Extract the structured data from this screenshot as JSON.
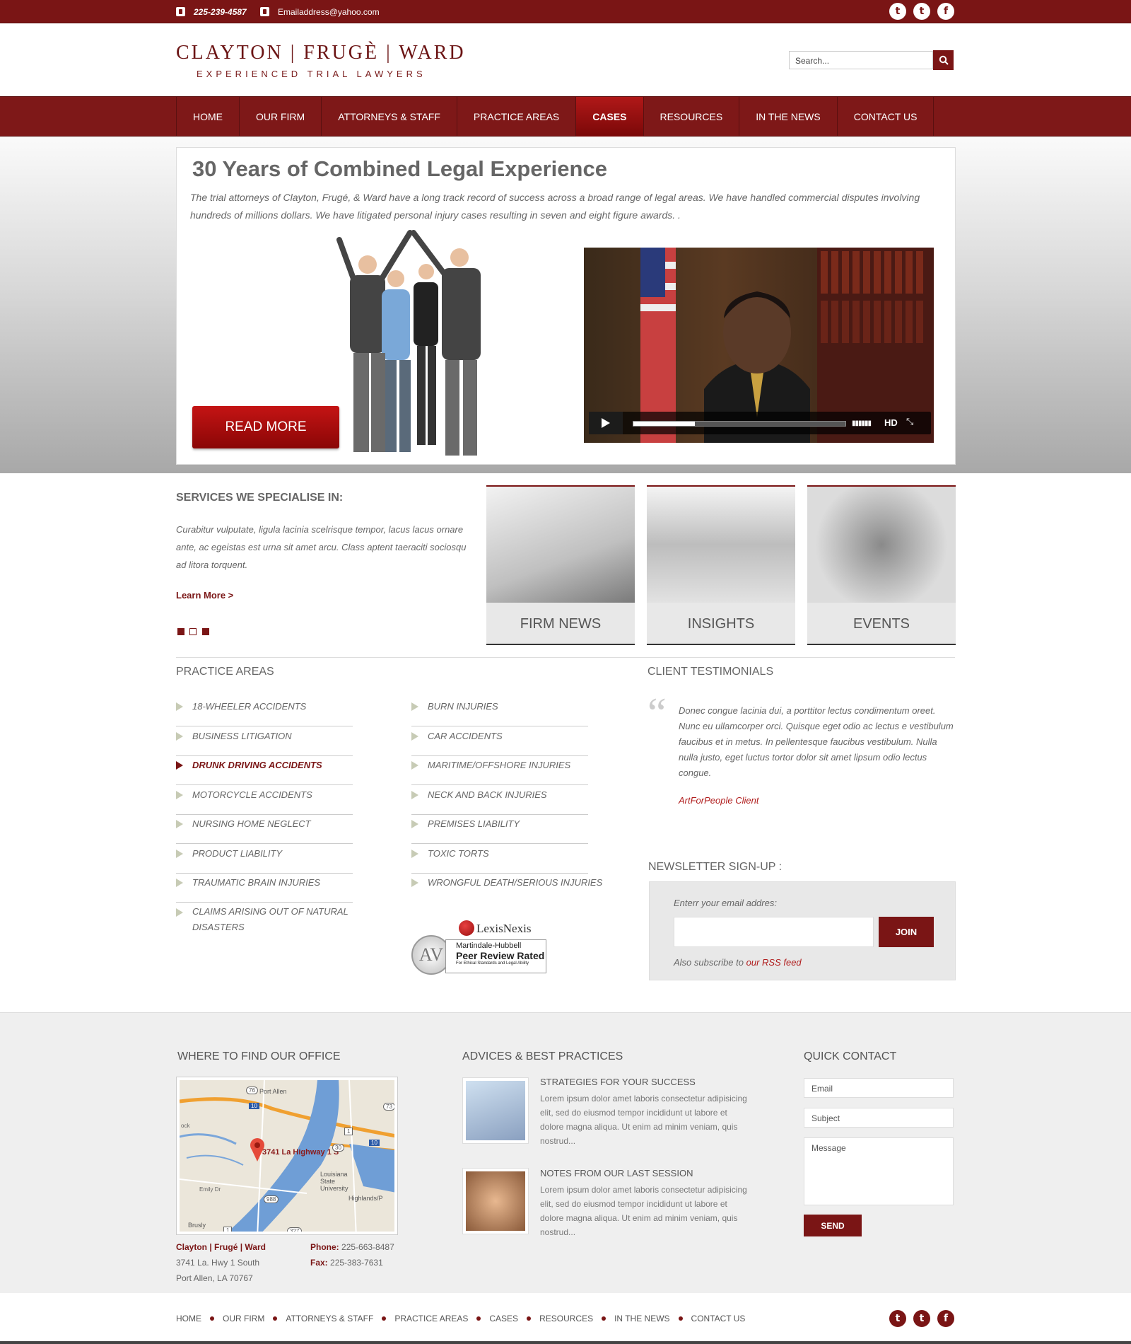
{
  "topbar": {
    "phone": "225-239-4587",
    "email": "Emailaddress@yahoo.com",
    "social": [
      "twitter-icon",
      "tumblr-icon",
      "facebook-icon"
    ]
  },
  "header": {
    "logo_title": "CLAYTON | FRUGÈ | WARD",
    "logo_subtitle": "EXPERIENCED TRIAL LAWYERS",
    "search_value": "Search..."
  },
  "nav": {
    "items": [
      "HOME",
      "OUR FIRM",
      "ATTORNEYS & STAFF",
      "PRACTICE AREAS",
      "CASES",
      "RESOURCES",
      "IN THE NEWS",
      "CONTACT US"
    ],
    "active": "CASES"
  },
  "hero": {
    "title": "30 Years of Combined Legal Experience",
    "text": "The trial attorneys of Clayton, Frugé, & Ward have a long track record of success across a broad range of legal areas. We have handled commercial disputes involving hundreds of millions dollars. We have litigated personal injury cases resulting in seven and eight figure awards. .",
    "button": "READ MORE",
    "video_hd": "HD",
    "video_progress": 0.29
  },
  "services": {
    "title": "SERVICES WE SPECIALISE IN:",
    "text": "Curabitur vulputate, ligula lacinia scelrisque tempor, lacus lacus ornare ante, ac egeistas est urna sit amet arcu. Class aptent taeraciti sociosqu ad litora torquent.",
    "learn_more": "Learn More   >",
    "cards": [
      "FIRM NEWS",
      "INSIGHTS",
      "EVENTS"
    ]
  },
  "practice": {
    "title": "PRACTICE AREAS",
    "col1": [
      "18-WHEELER ACCIDENTS",
      "BUSINESS LITIGATION",
      "DRUNK DRIVING ACCIDENTS",
      "MOTORCYCLE ACCIDENTS",
      "NURSING HOME NEGLECT",
      "PRODUCT LIABILITY",
      "TRAUMATIC BRAIN INJURIES",
      "CLAIMS ARISING OUT OF NATURAL DISASTERS"
    ],
    "col2": [
      "BURN INJURIES",
      "CAR ACCIDENTS",
      "MARITIME/OFFSHORE INJURIES",
      "NECK AND BACK INJURIES",
      "PREMISES LIABILITY",
      "TOXIC TORTS",
      "WRONGFUL DEATH/SERIOUS INJURIES"
    ],
    "active": "DRUNK DRIVING ACCIDENTS"
  },
  "lexis": {
    "brand": "LexisNexis",
    "line1": "Martindale-Hubbell",
    "line2": "Peer Review Rated",
    "line3": "For Ethical Standards and Legal Ability",
    "av": "AV"
  },
  "testimonials": {
    "title": "CLIENT TESTIMONIALS",
    "quote": "Donec congue lacinia dui, a porttitor lectus condimentum oreet. Nunc eu ullamcorper orci. Quisque eget odio ac lectus e vestibulum faucibus et in metus. In pellentesque faucibus vestibulum. Nulla nulla justo, eget luctus tortor dolor sit amet lipsum odio lectus congue.",
    "author": "ArtForPeople Client"
  },
  "newsletter": {
    "title": "NEWSLETTER SIGN-UP :",
    "label": "Enterr your email addres:",
    "button": "JOIN",
    "rss_prefix": "Also subscribe to ",
    "rss_link": "our RSS feed"
  },
  "footer": {
    "office_title": "WHERE TO FIND OUR OFFICE",
    "map_label": "3741 La Highway 1 S",
    "map_places": [
      "Port Allen",
      "Louisiana State University",
      "Highlands/P",
      "Emily Dr",
      "Brusly",
      "ock"
    ],
    "map_roads": [
      "76",
      "10",
      "73",
      "30",
      "10",
      "988",
      "327",
      "1",
      "1"
    ],
    "firm_parts": [
      "Clayton",
      "Frugé",
      "Ward"
    ],
    "address1": "3741 La. Hwy 1 South",
    "address2": "Port Allen, LA 70767",
    "phone_label": "Phone:",
    "phone": "225-663-8487",
    "fax_label": "Fax:",
    "fax": "225-383-7631",
    "advices_title": "ADVICES & BEST PRACTICES",
    "advices": [
      {
        "title": "STRATEGIES FOR YOUR SUCCESS",
        "text": "Lorem ipsum dolor amet laboris consectetur adipisicing elit, sed do eiusmod tempor incididunt ut labore et dolore magna aliqua. Ut enim ad minim veniam, quis nostrud..."
      },
      {
        "title": "NOTES FROM OUR LAST SESSION",
        "text": "Lorem ipsum dolor amet laboris consectetur adipisicing elit, sed do eiusmod tempor incididunt ut labore et dolore magna aliqua. Ut enim ad minim veniam, quis nostrud..."
      }
    ],
    "contact_title": "QUICK CONTACT",
    "email_ph": "Email",
    "subject_ph": "Subject",
    "message_ph": "Message",
    "send": "SEND",
    "nav": [
      "HOME",
      "OUR FIRM",
      "ATTORNEYS & STAFF",
      "PRACTICE AREAS",
      "CASES",
      "RESOURCES",
      "IN THE NEWS",
      "CONTACT US"
    ]
  },
  "colors": {
    "brand": "#7a1515",
    "accent_red": "#b01c1c"
  }
}
